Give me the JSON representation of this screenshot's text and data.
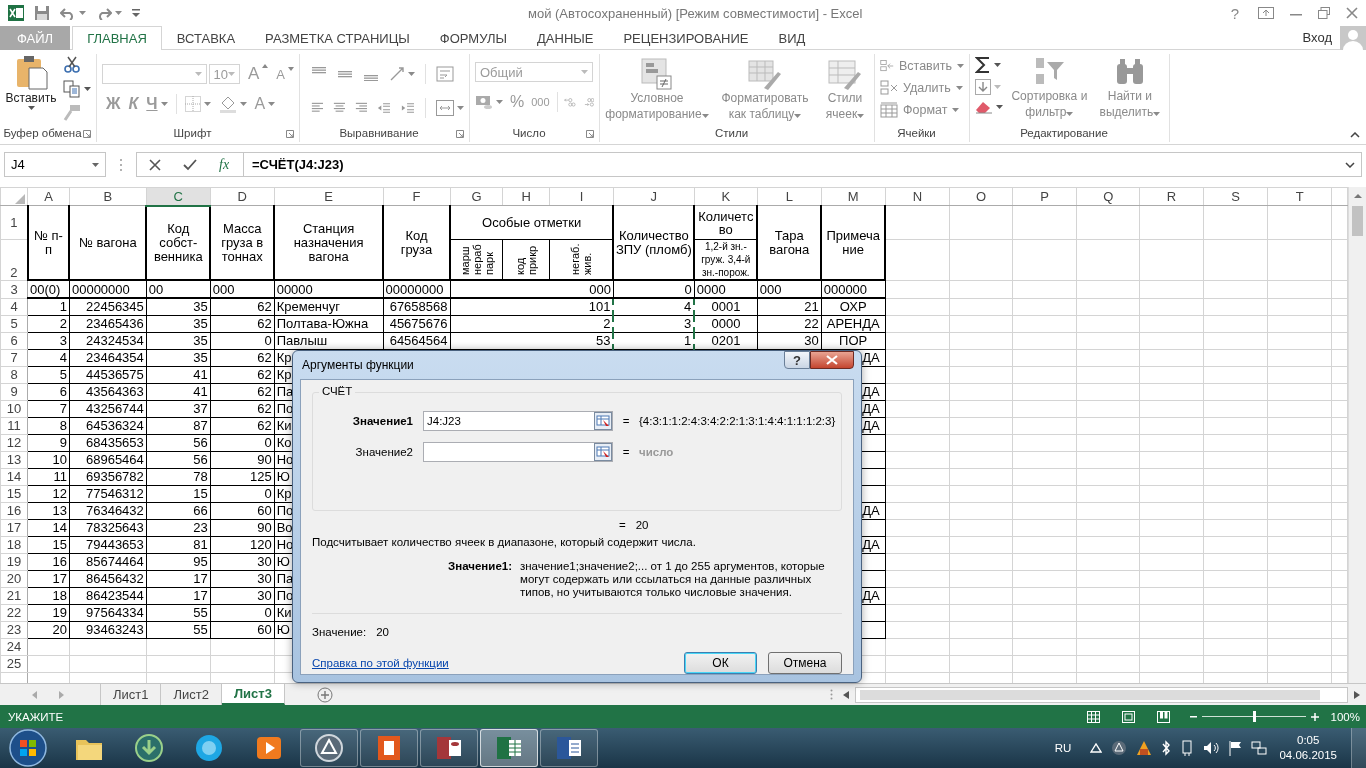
{
  "title_bar": {
    "title": "мой (Автосохраненный)  [Режим совместимости] - Excel",
    "help": "?"
  },
  "ribbon": {
    "tabs": [
      {
        "label": "ФАЙЛ",
        "kind": "file",
        "selected": false
      },
      {
        "label": "ГЛАВНАЯ",
        "kind": "tab",
        "selected": true
      },
      {
        "label": "ВСТАВКА",
        "kind": "tab",
        "selected": false
      },
      {
        "label": "РАЗМЕТКА СТРАНИЦЫ",
        "kind": "tab",
        "selected": false
      },
      {
        "label": "ФОРМУЛЫ",
        "kind": "tab",
        "selected": false
      },
      {
        "label": "ДАННЫЕ",
        "kind": "tab",
        "selected": false
      },
      {
        "label": "РЕЦЕНЗИРОВАНИЕ",
        "kind": "tab",
        "selected": false
      },
      {
        "label": "ВИД",
        "kind": "tab",
        "selected": false
      }
    ],
    "account": "Вход",
    "clipboard": {
      "label": "Буфер обмена",
      "paste": "Вставить"
    },
    "font": {
      "label": "Шрифт",
      "size": "10",
      "grow": "A",
      "shrink": "A",
      "bold": "Ж",
      "italic": "К",
      "underline": "Ч",
      "font_color_button": "A"
    },
    "alignment": {
      "label": "Выравнивание"
    },
    "number": {
      "label": "Число",
      "format": "Общий",
      "percent": "%",
      "thousands": "000"
    },
    "styles": {
      "label": "Стили",
      "buttons": [
        {
          "label": "Условное форматирование",
          "kind": "conditional"
        },
        {
          "label": "Форматировать как таблицу",
          "kind": "table"
        },
        {
          "label": "Стили ячеек",
          "kind": "cell"
        }
      ]
    },
    "cells": {
      "label": "Ячейки",
      "buttons": [
        {
          "label": "Вставить",
          "kind": "insert"
        },
        {
          "label": "Удалить",
          "kind": "delete"
        },
        {
          "label": "Формат",
          "kind": "format"
        }
      ]
    },
    "editing": {
      "label": "Редактирование",
      "buttons": [
        {
          "label": "Сортировка и фильтр",
          "kind": "sort"
        },
        {
          "label": "Найти и выделить",
          "kind": "find"
        }
      ]
    }
  },
  "formula_bar": {
    "name_box": "J4",
    "function_button": "fx",
    "formula": "=СЧЁТ(J4:J23)"
  },
  "sheet": {
    "columns": [
      {
        "label": "A",
        "selected": false,
        "marked": false
      },
      {
        "label": "B",
        "selected": false,
        "marked": false
      },
      {
        "label": "C",
        "selected": true,
        "marked": false
      },
      {
        "label": "D",
        "selected": false,
        "marked": false
      },
      {
        "label": "E",
        "selected": false,
        "marked": false
      },
      {
        "label": "F",
        "selected": false,
        "marked": false
      },
      {
        "label": "G",
        "selected": false,
        "marked": false
      },
      {
        "label": "H",
        "selected": false,
        "marked": false
      },
      {
        "label": "I",
        "selected": false,
        "marked": false
      },
      {
        "label": "J",
        "selected": false,
        "marked": true
      },
      {
        "label": "K",
        "selected": false,
        "marked": false
      },
      {
        "label": "L",
        "selected": false,
        "marked": false
      },
      {
        "label": "M",
        "selected": false,
        "marked": false
      },
      {
        "label": "N",
        "selected": false,
        "marked": false
      },
      {
        "label": "O",
        "selected": false,
        "marked": false
      },
      {
        "label": "P",
        "selected": false,
        "marked": false
      },
      {
        "label": "Q",
        "selected": false,
        "marked": false
      },
      {
        "label": "R",
        "selected": false,
        "marked": false
      },
      {
        "label": "S",
        "selected": false,
        "marked": false
      },
      {
        "label": "T",
        "selected": false,
        "marked": false
      }
    ],
    "header_rows": [
      "1",
      "2"
    ],
    "header_cells": [
      {
        "text": "№ п-п",
        "kind": "tall"
      },
      {
        "text": "№ вагона",
        "kind": "tall"
      },
      {
        "text": "Код собст-венника",
        "kind": "tall"
      },
      {
        "text": "Масса груза в тоннах",
        "kind": "tall"
      },
      {
        "text": "Станция назначения вагона",
        "kind": "tall"
      },
      {
        "text": "Код груза",
        "kind": "tall"
      },
      {
        "text": "Особые отметки",
        "kind": "group"
      },
      {
        "text": "Количество ЗПУ (пломб)",
        "kind": "tall"
      },
      {
        "text": "Количетс во",
        "kind": "upper"
      },
      {
        "text": "Тара вагона",
        "kind": "tall"
      },
      {
        "text": "Примеча ние",
        "kind": "tall"
      },
      {
        "text": "марш нераб парк",
        "kind": "vertical"
      },
      {
        "text": "код прикр",
        "kind": "vertical"
      },
      {
        "text": "негаб. жив.",
        "kind": "vertical"
      },
      {
        "text": "1,2-й зн.-груж. 3,4-й зн.-порож.",
        "kind": "lower"
      }
    ],
    "rows": [
      {
        "number": "3",
        "kind": "format",
        "cells": {
          "A": "00(0)",
          "B": "00000000",
          "C": "00",
          "D": "000",
          "E": "00000",
          "F": "00000000",
          "GI": "000",
          "J": "0",
          "K": "0000",
          "L": "000",
          "M": "000000"
        }
      },
      {
        "number": "4",
        "kind": "data",
        "cells": {
          "A": "1",
          "B": "22456345",
          "C": "35",
          "D": "62",
          "E": "Кременчуг",
          "F": "67658568",
          "GI": "101",
          "J": "4",
          "K": "0001",
          "L": "21",
          "M": "ОХР"
        }
      },
      {
        "number": "5",
        "kind": "data",
        "cells": {
          "A": "2",
          "B": "23465436",
          "C": "35",
          "D": "62",
          "E": "Полтава-Южна",
          "F": "45675676",
          "GI": "2",
          "J": "3",
          "K": "0000",
          "L": "22",
          "M": "АРЕНДА"
        }
      },
      {
        "number": "6",
        "kind": "data",
        "cells": {
          "A": "3",
          "B": "24324534",
          "C": "35",
          "D": "0",
          "E": "Павлыш",
          "F": "64564564",
          "GI": "53",
          "J": "1",
          "K": "0201",
          "L": "30",
          "M": "ПОР"
        }
      },
      {
        "number": "7",
        "kind": "covered",
        "cells": {
          "A": "4",
          "B": "23464354",
          "C": "35",
          "D": "62",
          "E": "Кр",
          "M": "ДА"
        }
      },
      {
        "number": "8",
        "kind": "covered",
        "cells": {
          "A": "5",
          "B": "44536575",
          "C": "41",
          "D": "62",
          "E": "Кр"
        }
      },
      {
        "number": "9",
        "kind": "covered",
        "cells": {
          "A": "6",
          "B": "43564363",
          "C": "41",
          "D": "62",
          "E": "Па",
          "M": "ДА"
        }
      },
      {
        "number": "10",
        "kind": "covered",
        "cells": {
          "A": "7",
          "B": "43256744",
          "C": "37",
          "D": "62",
          "E": "По",
          "M": "ДА"
        }
      },
      {
        "number": "11",
        "kind": "covered",
        "cells": {
          "A": "8",
          "B": "64536324",
          "C": "87",
          "D": "62",
          "E": "Ки",
          "M": "ДА"
        }
      },
      {
        "number": "12",
        "kind": "covered",
        "cells": {
          "A": "9",
          "B": "68435653",
          "C": "56",
          "D": "0",
          "E": "Ко"
        }
      },
      {
        "number": "13",
        "kind": "covered",
        "cells": {
          "A": "10",
          "B": "68965464",
          "C": "56",
          "D": "90",
          "E": "Но"
        }
      },
      {
        "number": "14",
        "kind": "covered",
        "cells": {
          "A": "11",
          "B": "69356782",
          "C": "78",
          "D": "125",
          "E": "Ю"
        }
      },
      {
        "number": "15",
        "kind": "covered",
        "cells": {
          "A": "12",
          "B": "77546312",
          "C": "15",
          "D": "0",
          "E": "Кр"
        }
      },
      {
        "number": "16",
        "kind": "covered",
        "cells": {
          "A": "13",
          "B": "76346432",
          "C": "66",
          "D": "60",
          "E": "По",
          "M": "ДА"
        }
      },
      {
        "number": "17",
        "kind": "covered",
        "cells": {
          "A": "14",
          "B": "78325643",
          "C": "23",
          "D": "90",
          "E": "Во"
        }
      },
      {
        "number": "18",
        "kind": "covered",
        "cells": {
          "A": "15",
          "B": "79443653",
          "C": "81",
          "D": "120",
          "E": "Но",
          "M": "ДА"
        }
      },
      {
        "number": "19",
        "kind": "covered",
        "cells": {
          "A": "16",
          "B": "85674464",
          "C": "95",
          "D": "30",
          "E": "Ю"
        }
      },
      {
        "number": "20",
        "kind": "covered",
        "cells": {
          "A": "17",
          "B": "86456432",
          "C": "17",
          "D": "30",
          "E": "Па"
        }
      },
      {
        "number": "21",
        "kind": "covered",
        "cells": {
          "A": "18",
          "B": "86423544",
          "C": "17",
          "D": "30",
          "E": "По",
          "M": "ДА"
        }
      },
      {
        "number": "22",
        "kind": "covered",
        "cells": {
          "A": "19",
          "B": "97564334",
          "C": "55",
          "D": "0",
          "E": "Ки"
        }
      },
      {
        "number": "23",
        "kind": "covered",
        "cells": {
          "A": "20",
          "B": "93463243",
          "C": "55",
          "D": "60",
          "E": "Ю"
        }
      },
      {
        "number": "24",
        "kind": "empty"
      },
      {
        "number": "25",
        "kind": "empty"
      }
    ]
  },
  "dialog": {
    "title": "Аргументы функции",
    "help": "?",
    "function": "СЧЁТ",
    "arguments": [
      {
        "label": "Значение1",
        "value": "J4:J23",
        "equals": "=",
        "result": "{4:3:1:1:2:4:3:4:2:2:1:3:1:4:4:1:1:1:2:3}",
        "kind": "value",
        "selected": true
      },
      {
        "label": "Значение2",
        "equals": "=",
        "result": "число",
        "kind": "hint",
        "selected": false
      }
    ],
    "total": {
      "equals": "=",
      "value": "20"
    },
    "description": "Подсчитывает количество ячеек в диапазоне, который содержит числа.",
    "argument_help": {
      "label": "Значение1:",
      "text": "значение1;значение2;... от 1 до 255 аргументов, которые могут содержать или ссылаться на данные различных типов, но учитываются только числовые значения."
    },
    "result": {
      "label": "Значение:",
      "value": "20"
    },
    "help_link": "Справка по этой функции",
    "buttons": [
      {
        "label": "ОК",
        "default": true
      },
      {
        "label": "Отмена",
        "default": false
      }
    ]
  },
  "sheet_tabs": [
    {
      "label": "Лист1",
      "selected": false
    },
    {
      "label": "Лист2",
      "selected": false
    },
    {
      "label": "Лист3",
      "selected": true
    }
  ],
  "status_bar": {
    "mode": "УКАЖИТЕ",
    "zoom": "100%",
    "zoom_slider": {
      "level": 0.5
    }
  },
  "taskbar": {
    "apps": [
      {
        "kind": "folder",
        "running": false,
        "selected": false
      },
      {
        "kind": "download",
        "running": false,
        "selected": false
      },
      {
        "kind": "chat",
        "running": false,
        "selected": false
      },
      {
        "kind": "media",
        "running": false,
        "selected": false
      },
      {
        "kind": "circle",
        "running": true,
        "selected": false
      },
      {
        "kind": "office",
        "running": true,
        "selected": false
      },
      {
        "kind": "database",
        "running": true,
        "selected": false
      },
      {
        "kind": "spreadsheet",
        "running": true,
        "selected": true
      },
      {
        "kind": "document",
        "running": true,
        "selected": false
      }
    ],
    "language": "RU",
    "time": "0:05",
    "date": "04.06.2015"
  }
}
